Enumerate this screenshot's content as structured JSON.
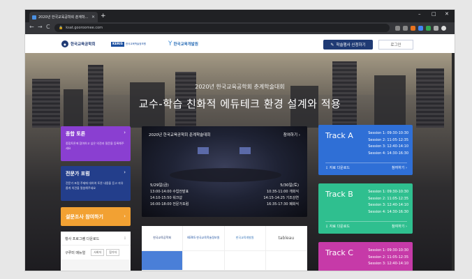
{
  "browser": {
    "tab_title": "2020년 한국교육공학회 춘계학...",
    "new_tab": "+",
    "url": "ksat.gooroomee.com",
    "win_min": "–",
    "win_max": "□",
    "win_close": "✕",
    "back": "←",
    "forward": "→",
    "reload": "C"
  },
  "header": {
    "logo1": "한국교육공학회",
    "logo2_mark": "KERIS",
    "logo2_sub": "한국교육학술정보원",
    "logo3": "한국교육개발원",
    "apply_button": "학술행사 신청하기",
    "login_button": "로그인"
  },
  "hero": {
    "subtitle": "2020년 한국교육공학회 춘계학술대회",
    "title": "교수-학습 친화적 에듀테크 환경 설계와 적용"
  },
  "sidebar": {
    "card1": {
      "title": "종합 토론",
      "desc": "종합토론에 참여하고 싶은 의견과 질문을 등록해주세요",
      "color": "#8a3fd1"
    },
    "card2": {
      "title": "전문가 포럼",
      "desc": "전문가 포럼 주제에 대하여 토론 내용을 듣고 자유롭게 의견을 말씀해주세요",
      "color": "#233e8b"
    },
    "card3": {
      "title": "설문조사 참여하기",
      "color": "#f2a133"
    },
    "download_label": "행사 프로그램 다운로드",
    "manual_label": "구루미 매뉴얼",
    "manual_btn1": "사회자",
    "manual_btn2": "참가자"
  },
  "center": {
    "heading": "2020년 한국교육공학회 춘계학술대회",
    "join": "참여하기 ›",
    "day1": "5/29일(금)",
    "day1_items": [
      "13:00-14:00 수업전발표",
      "14:10-15:50 워크샵",
      "16:00-18:00 전문가포럼"
    ],
    "day2": "5/30일(토)",
    "day2_items": [
      "10:35-11:00 개회식",
      "14:15-14:25 기조강연",
      "16:35-17:30 폐회식"
    ]
  },
  "partners": [
    "한국교육공학회",
    "KERIS 한국교육학술정보원",
    "한국교육개발원",
    "tableau"
  ],
  "tracks": [
    {
      "name": "Track A",
      "color": "#2f6fd6",
      "sessions": [
        "Session 1: 09:30-10:30",
        "Session 2: 11:05-12:35",
        "Session 3: 12:40-14:10",
        "Session 4: 14:30-16:30"
      ],
      "download": "자료 다운로드",
      "join": "참여하기 ›"
    },
    {
      "name": "Track B",
      "color": "#2fbf8f",
      "sessions": [
        "Session 1: 09:30-10:30",
        "Session 2: 11:05-12:35",
        "Session 3: 12:40-14:10",
        "Session 4: 14:30-16:30"
      ],
      "download": "자료 다운로드",
      "join": "참여하기 ›"
    },
    {
      "name": "Track C",
      "color": "#c63aa8",
      "sessions": [
        "Session 1: 09:30-10:30",
        "Session 2: 11:05-12:35",
        "Session 3: 12:40-14:10"
      ],
      "download": "",
      "join": ""
    }
  ]
}
